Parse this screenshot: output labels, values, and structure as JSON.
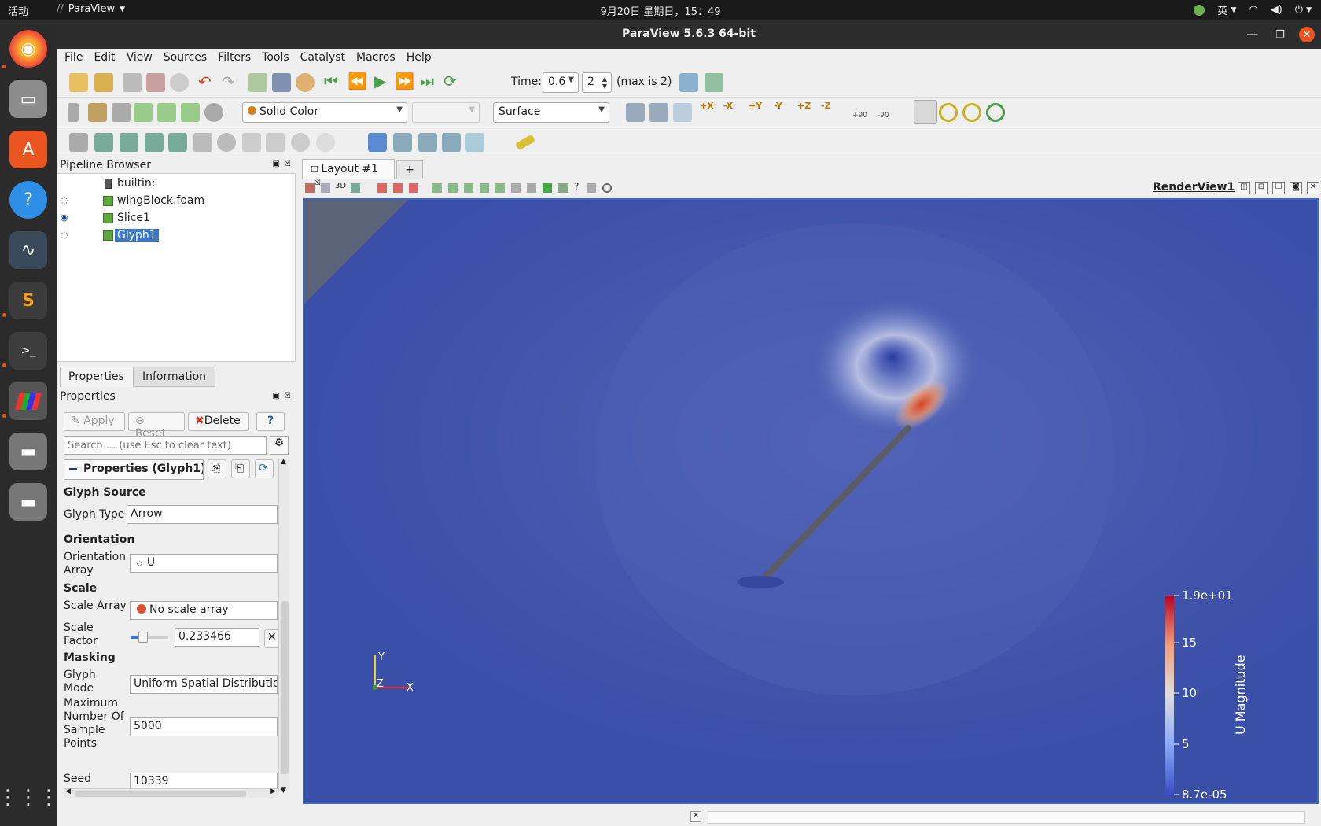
{
  "system": {
    "activities": "活动",
    "app_name": "ParaView",
    "clock": "9月20日 星期日，15：49",
    "input_method": "英"
  },
  "window": {
    "title": "ParaView 5.6.3 64-bit"
  },
  "menu": [
    "File",
    "Edit",
    "View",
    "Sources",
    "Filters",
    "Tools",
    "Catalyst",
    "Macros",
    "Help"
  ],
  "time": {
    "label": "Time:",
    "value": "0.6",
    "step": "2",
    "max": "(max is 2)"
  },
  "display": {
    "coloring": "Solid Color",
    "component": "",
    "representation": "Surface"
  },
  "camera_buttons": [
    "+X",
    "-X",
    "+Y",
    "-Y",
    "+Z",
    "-Z",
    "+90",
    "-90"
  ],
  "pipeline": {
    "title": "Pipeline Browser",
    "items": [
      {
        "label": "builtin:",
        "visible": null
      },
      {
        "label": "wingBlock.foam",
        "visible": false
      },
      {
        "label": "Slice1",
        "visible": true
      },
      {
        "label": "Glyph1",
        "visible": false,
        "selected": true
      }
    ]
  },
  "panel_tabs": [
    "Properties",
    "Information"
  ],
  "properties": {
    "title": "Properties",
    "apply": "Apply",
    "reset": "Reset",
    "delete": "Delete",
    "help": "?",
    "search_placeholder": "Search ... (use Esc to clear text)",
    "group_label": "Properties (Glyph1)",
    "sections": {
      "glyph_source": "Glyph Source",
      "orientation": "Orientation",
      "scale": "Scale",
      "masking": "Masking"
    },
    "glyph_type_label": "Glyph Type",
    "glyph_type": "Arrow",
    "orientation_label": "Orientation Array",
    "orientation_value": "U",
    "scale_array_label": "Scale Array",
    "scale_array_value": "No scale array",
    "scale_factor_label": "Scale Factor",
    "scale_factor_value": "0.233466",
    "glyph_mode_label": "Glyph Mode",
    "glyph_mode_value": "Uniform Spatial Distribution",
    "max_samples_label": "Maximum Number Of Sample Points",
    "max_samples_value": "5000",
    "seed_label": "Seed",
    "seed_value": "10339"
  },
  "layout": {
    "tab": "Layout #1",
    "add": "+",
    "view_name": "RenderView1",
    "mode_3d": "3D"
  },
  "colorbar": {
    "title": "U Magnitude",
    "labels": [
      "1.9e+01",
      "15",
      "10",
      "5",
      "8.7e-05"
    ]
  },
  "axes": {
    "x": "X",
    "y": "Y",
    "z": "Z"
  },
  "colors": {
    "background": "#3a4fa8",
    "highlight": "#e04020",
    "accent": "#3a68c9"
  }
}
